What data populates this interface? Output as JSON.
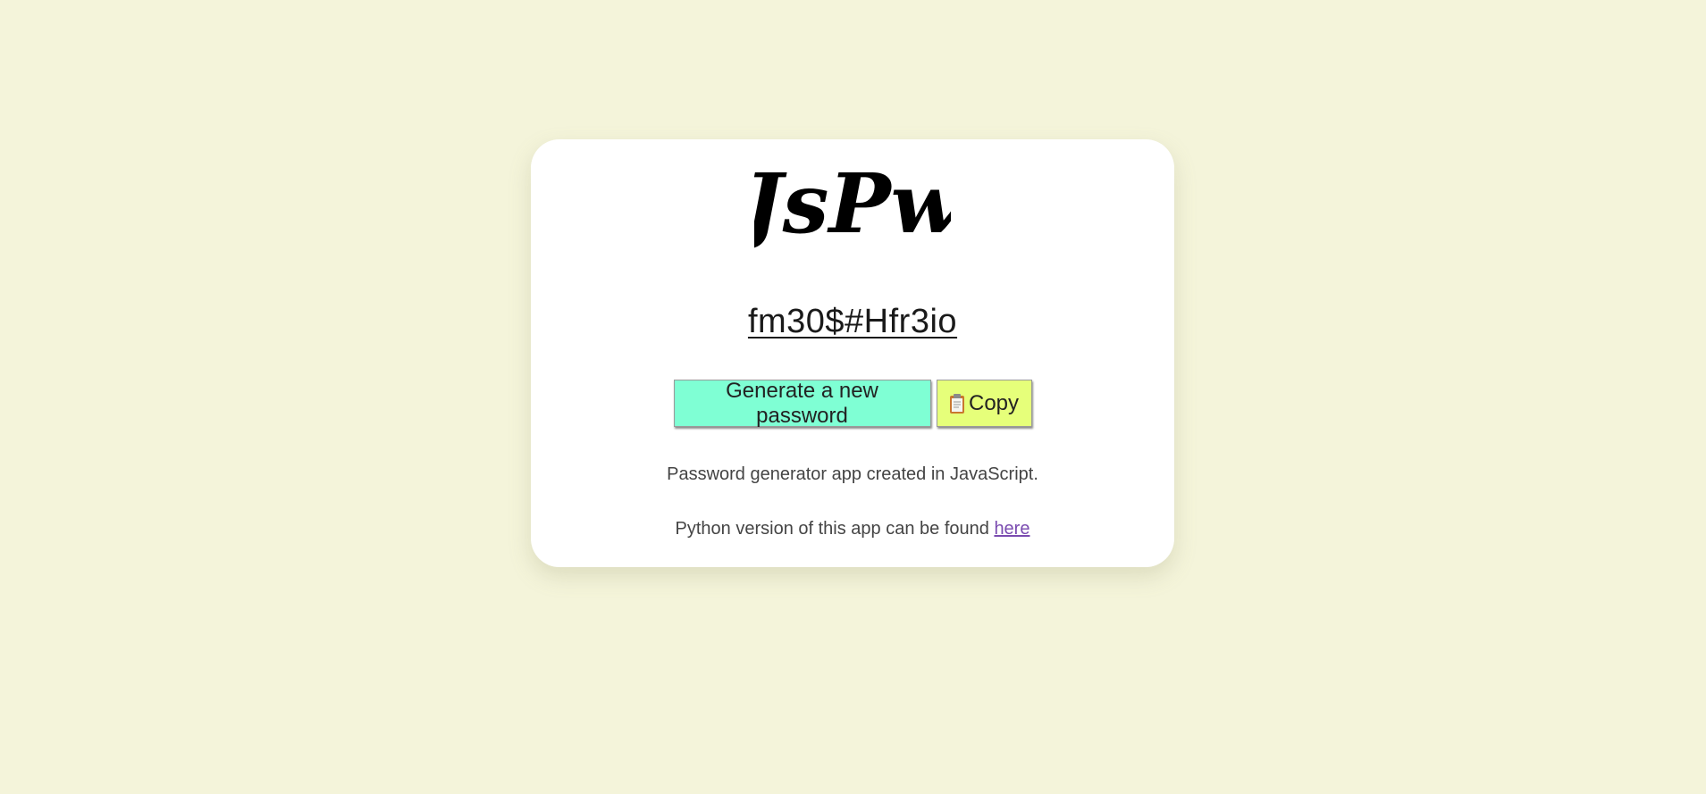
{
  "app": {
    "logo_text": "JsPw"
  },
  "password": {
    "value": "fm30$#Hfr3io"
  },
  "buttons": {
    "generate_label": "Generate a new password",
    "copy_label": "Copy",
    "copy_icon": "clipboard-icon"
  },
  "info": {
    "description": "Password generator app created in JavaScript.",
    "python_text": "Python version of this app can be found ",
    "python_link_text": "here"
  },
  "colors": {
    "background": "#f4f4da",
    "card": "#ffffff",
    "generate_button": "#7fffd4",
    "copy_button": "#e6ff7a",
    "link": "#7a4bb0"
  }
}
